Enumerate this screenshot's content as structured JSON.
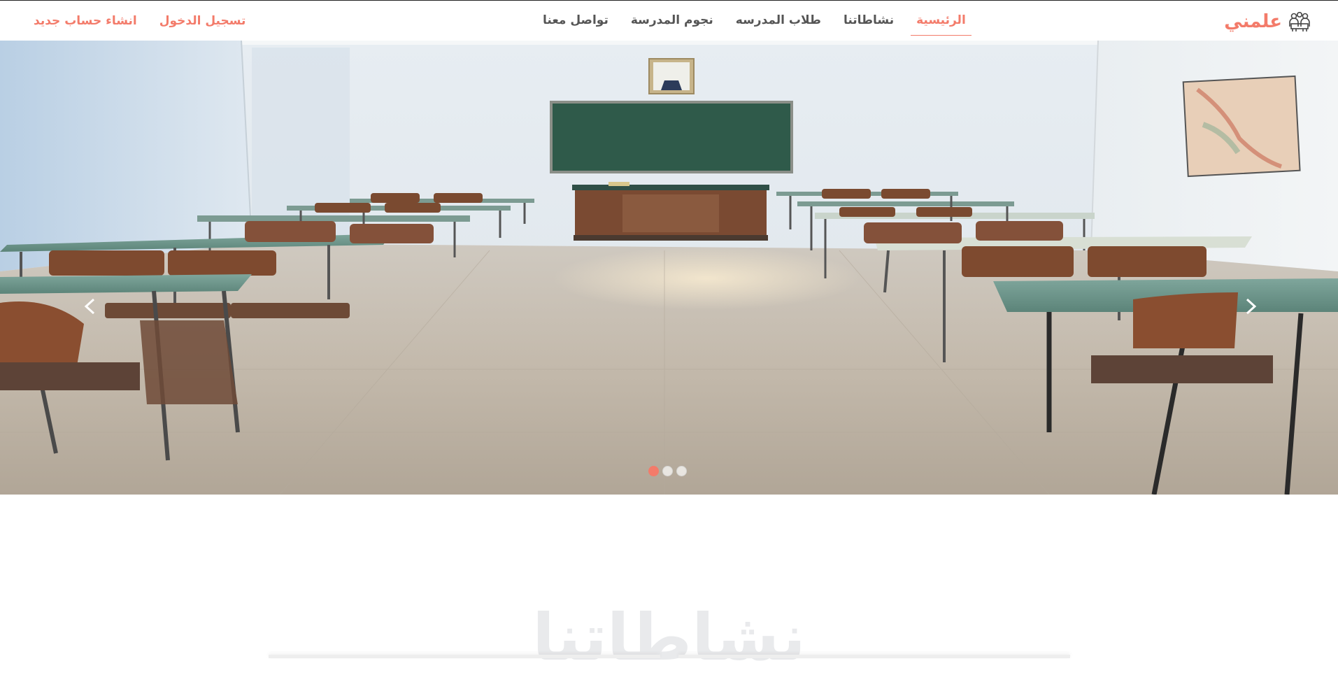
{
  "brand": {
    "name": "علمني",
    "icon": "students-group-icon"
  },
  "nav": {
    "items": [
      {
        "label": "الرئيسية",
        "active": true
      },
      {
        "label": "نشاطاتنا",
        "active": false
      },
      {
        "label": "طلاب المدرسه",
        "active": false
      },
      {
        "label": "نجوم المدرسة",
        "active": false
      },
      {
        "label": "تواصل معنا",
        "active": false
      }
    ]
  },
  "auth": {
    "login_label": "تسجيل الدخول",
    "signup_label": "انشاء حساب جديد"
  },
  "carousel": {
    "image": "empty-classroom-photo",
    "prev_icon": "chevron-left-icon",
    "next_icon": "chevron-right-icon",
    "slide_count": 3,
    "active_slide": 1
  },
  "section": {
    "title": "نشاطاتنا"
  },
  "colors": {
    "accent": "#f37b6a",
    "nav_text": "#555555",
    "watermark": "#e9eaec"
  }
}
